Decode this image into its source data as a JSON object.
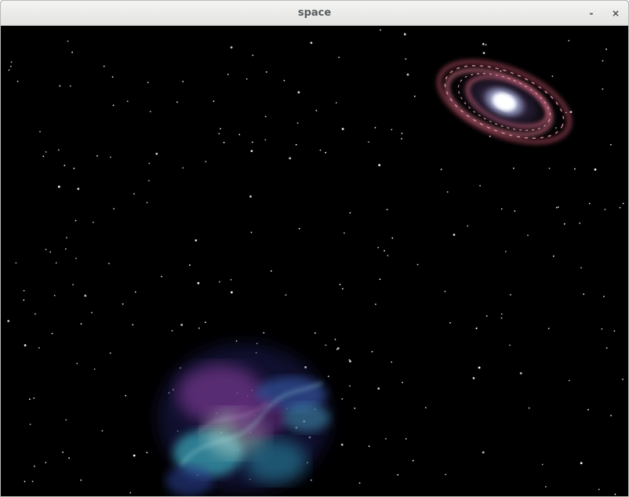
{
  "window": {
    "title": "space",
    "minimize_label": "-",
    "close_label": "×"
  },
  "scene": {
    "background_color": "#000000",
    "star_color": "#ffffff",
    "galaxy": {
      "name": "spiral-galaxy",
      "core_color": "#dfe8ff",
      "arm_color": "#d86a86"
    },
    "nebula": {
      "name": "nebula",
      "colors": [
        "#3fb8c8",
        "#8a3fa0",
        "#cfe6d6",
        "#2a3f8f"
      ]
    }
  }
}
